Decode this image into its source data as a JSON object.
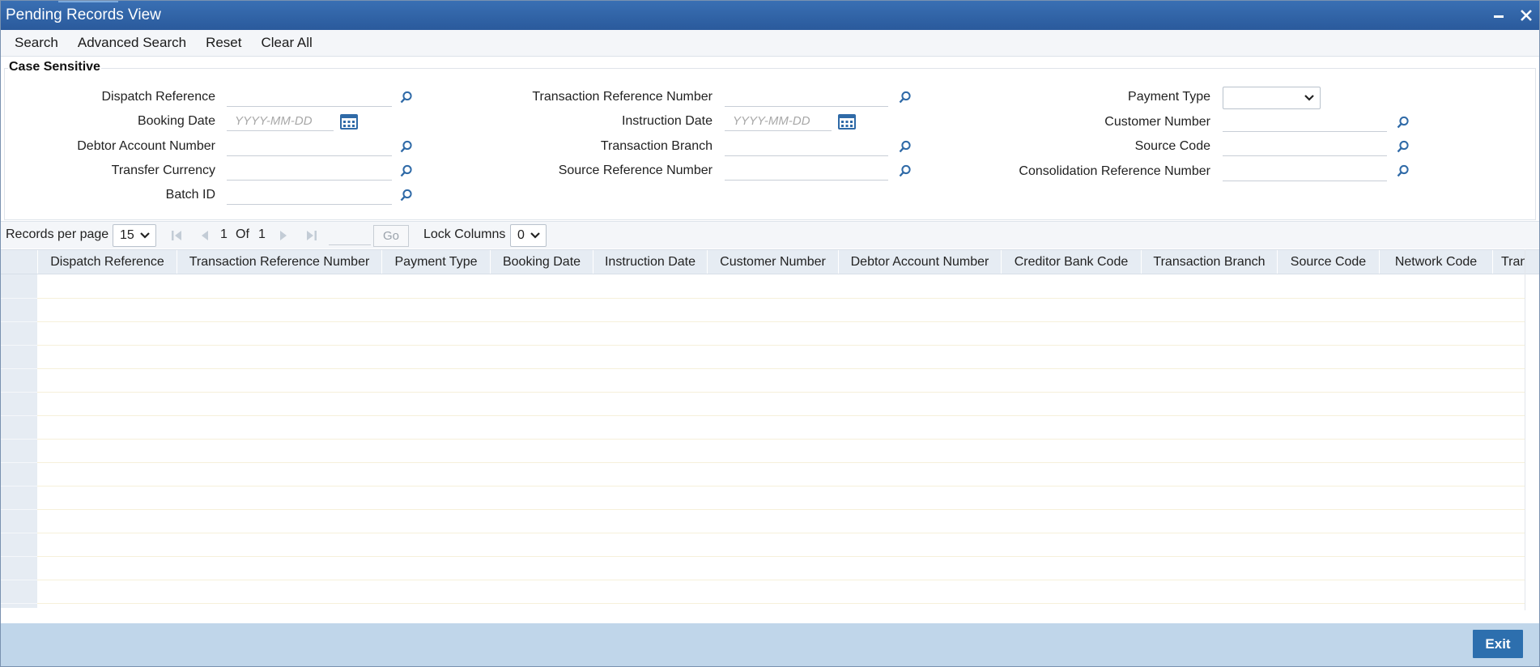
{
  "window": {
    "title": "Pending Records View"
  },
  "menu": {
    "search": "Search",
    "advanced_search": "Advanced Search",
    "reset": "Reset",
    "clear_all": "Clear All"
  },
  "section": {
    "legend": "Case Sensitive"
  },
  "fields": {
    "dispatch_reference": {
      "label": "Dispatch Reference",
      "value": ""
    },
    "booking_date": {
      "label": "Booking Date",
      "placeholder": "YYYY-MM-DD"
    },
    "debtor_account_number": {
      "label": "Debtor Account Number",
      "value": ""
    },
    "transfer_currency": {
      "label": "Transfer Currency",
      "value": ""
    },
    "batch_id": {
      "label": "Batch ID",
      "value": ""
    },
    "transaction_reference_number": {
      "label": "Transaction Reference Number",
      "value": ""
    },
    "instruction_date": {
      "label": "Instruction Date",
      "placeholder": "YYYY-MM-DD"
    },
    "transaction_branch": {
      "label": "Transaction Branch",
      "value": ""
    },
    "source_reference_number": {
      "label": "Source Reference Number",
      "value": ""
    },
    "payment_type": {
      "label": "Payment Type",
      "selected": ""
    },
    "customer_number": {
      "label": "Customer Number",
      "value": ""
    },
    "source_code": {
      "label": "Source Code",
      "value": ""
    },
    "consolidation_reference_number": {
      "label": "Consolidation Reference Number",
      "value": ""
    }
  },
  "pager": {
    "records_per_page_label": "Records per page",
    "records_per_page": "15",
    "current_page": "1",
    "of_label": "Of",
    "total_pages": "1",
    "go_label": "Go",
    "lock_columns_label": "Lock Columns",
    "lock_columns": "0"
  },
  "grid": {
    "columns": [
      "Dispatch Reference",
      "Transaction Reference Number",
      "Payment Type",
      "Booking Date",
      "Instruction Date",
      "Customer Number",
      "Debtor Account Number",
      "Creditor Bank Code",
      "Transaction Branch",
      "Source Code",
      "Network Code",
      "Tran"
    ]
  },
  "footer": {
    "exit": "Exit"
  },
  "colors": {
    "titlebar": "#2f62a6",
    "footer": "#c0d6ea",
    "exit_button": "#2d6fae",
    "grid_header": "#e6ecf3"
  },
  "icons": [
    "minimize-icon",
    "close-icon",
    "search-lens-icon",
    "calendar-icon",
    "chevron-down-icon",
    "first-page-icon",
    "previous-page-icon",
    "next-page-icon",
    "last-page-icon"
  ]
}
